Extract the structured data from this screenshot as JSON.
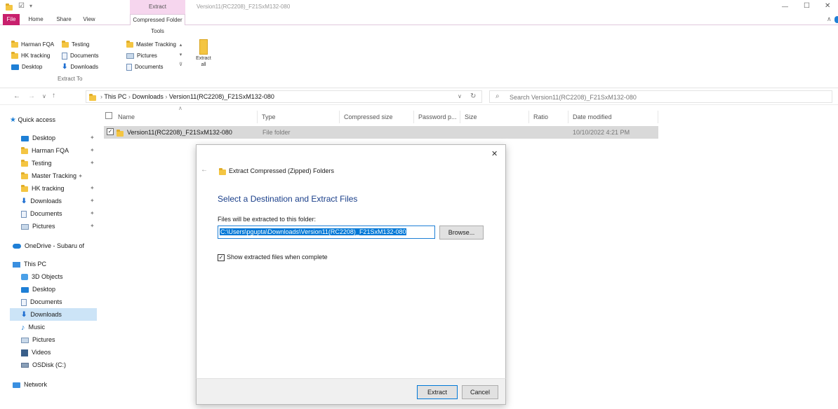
{
  "titlebar": {
    "contextual_tab": "Extract",
    "title": "Version11(RC2208)_F21SxM132-080",
    "minimize": "—",
    "maximize": "☐",
    "close": "✕"
  },
  "ribbon_tabs": [
    "File",
    "Home",
    "Share",
    "View",
    "Compressed Folder Tools"
  ],
  "ribbon": {
    "extract_to_items": [
      [
        "Harman FQA",
        "Testing",
        "Master Tracking"
      ],
      [
        "HK tracking",
        "Documents",
        "Pictures"
      ],
      [
        "Desktop",
        "Downloads",
        "Documents"
      ]
    ],
    "extract_to_label": "Extract To",
    "extract_all_label_1": "Extract",
    "extract_all_label_2": "all"
  },
  "address": {
    "path": [
      "This PC",
      "Downloads",
      "Version11(RC2208)_F21SxM132-080"
    ],
    "search_placeholder": "Search Version11(RC2208)_F21SxM132-080"
  },
  "nav": {
    "quick_access": "Quick access",
    "quick_items": [
      "Desktop",
      "Harman FQA",
      "Testing",
      "Master Tracking",
      "HK tracking",
      "Downloads",
      "Documents",
      "Pictures"
    ],
    "onedrive": "OneDrive - Subaru of",
    "this_pc": "This PC",
    "pc_items": [
      "3D Objects",
      "Desktop",
      "Documents",
      "Downloads",
      "Music",
      "Pictures",
      "Videos",
      "OSDisk (C:)"
    ],
    "network": "Network"
  },
  "columns": [
    "Name",
    "Type",
    "Compressed size",
    "Password p...",
    "Size",
    "Ratio",
    "Date modified"
  ],
  "files": [
    {
      "name": "Version11(RC2208)_F21SxM132-080",
      "type": "File folder",
      "date": "10/10/2022 4:21 PM"
    }
  ],
  "dialog": {
    "window_title": "Extract Compressed (Zipped) Folders",
    "heading": "Select a Destination and Extract Files",
    "field_label": "Files will be extracted to this folder:",
    "path_value": "C:\\Users\\pgupta\\Downloads\\Version11(RC2208)_F21SxM132-080",
    "browse": "Browse...",
    "checkbox_label": "Show extracted files when complete",
    "extract": "Extract",
    "cancel": "Cancel",
    "close": "✕"
  }
}
